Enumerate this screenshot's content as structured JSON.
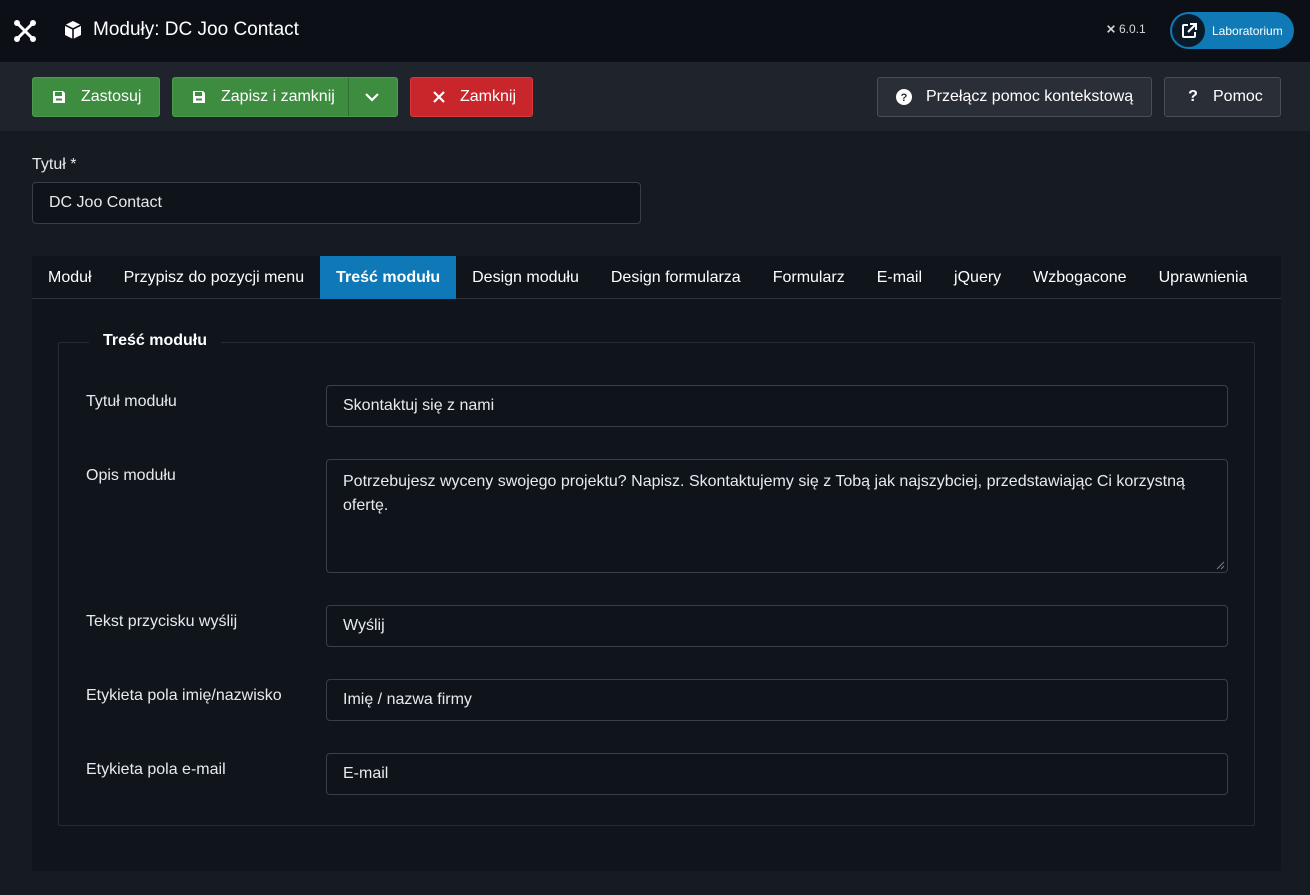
{
  "header": {
    "page_title": "Moduły: DC Joo Contact",
    "version": "6.0.1",
    "site_button": "Laboratorium"
  },
  "toolbar": {
    "apply": "Zastosuj",
    "save_close": "Zapisz i zamknij",
    "close": "Zamknij",
    "toggle_help": "Przełącz pomoc kontekstową",
    "help": "Pomoc"
  },
  "form": {
    "title_label": "Tytuł *",
    "title_value": "DC Joo Contact"
  },
  "tabs": [
    {
      "label": "Moduł"
    },
    {
      "label": "Przypisz do pozycji menu"
    },
    {
      "label": "Treść modułu"
    },
    {
      "label": "Design modułu"
    },
    {
      "label": "Design formularza"
    },
    {
      "label": "Formularz"
    },
    {
      "label": "E-mail"
    },
    {
      "label": "jQuery"
    },
    {
      "label": "Wzbogacone"
    },
    {
      "label": "Uprawnienia"
    }
  ],
  "active_tab": "Treść modułu",
  "content": {
    "legend": "Treść modułu",
    "fields": [
      {
        "label": "Tytuł modułu",
        "value": "Skontaktuj się z nami"
      },
      {
        "label": "Opis modułu",
        "value": "Potrzebujesz wyceny swojego projektu? Napisz. Skontaktujemy się z Tobą jak najszybciej, przedstawiając Ci korzystną ofertę."
      },
      {
        "label": "Tekst przycisku wyślij",
        "value": "Wyślij"
      },
      {
        "label": "Etykieta pola imię/nazwisko",
        "value": "Imię / nazwa firmy"
      },
      {
        "label": "Etykieta pola e-mail",
        "value": "E-mail"
      }
    ]
  },
  "colors": {
    "accent": "#0f78b6",
    "green": "#3d8c3f",
    "red": "#c8262a",
    "background": "#161a21"
  },
  "icons": [
    "joomla-logo-icon",
    "cube-icon",
    "external-link-icon",
    "floppy-disk-icon",
    "chevron-down-icon",
    "close-icon",
    "question-circle-icon",
    "question-icon"
  ]
}
